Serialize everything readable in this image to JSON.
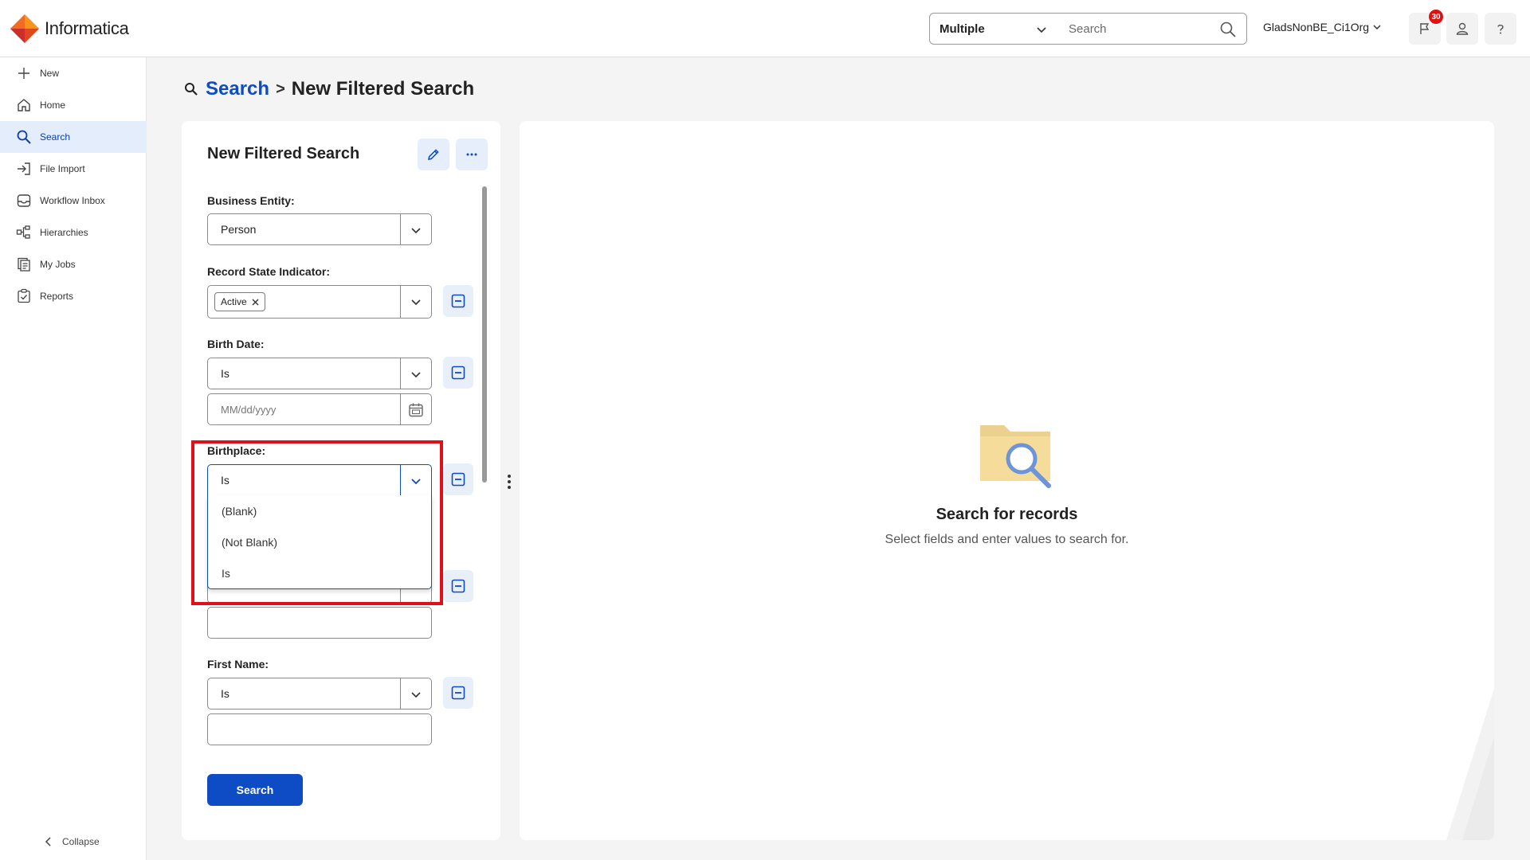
{
  "header": {
    "logo_text": "Informatica",
    "scope_select": "Multiple",
    "search_placeholder": "Search",
    "org_name": "GladsNonBE_Ci1Org",
    "notification_count": "30"
  },
  "sidebar": {
    "items": [
      {
        "label": "New",
        "icon": "plus-icon"
      },
      {
        "label": "Home",
        "icon": "home-icon"
      },
      {
        "label": "Search",
        "icon": "search-icon"
      },
      {
        "label": "File Import",
        "icon": "file-import-icon"
      },
      {
        "label": "Workflow Inbox",
        "icon": "inbox-icon"
      },
      {
        "label": "Hierarchies",
        "icon": "hierarchy-icon"
      },
      {
        "label": "My Jobs",
        "icon": "jobs-icon"
      },
      {
        "label": "Reports",
        "icon": "reports-icon"
      }
    ],
    "active": "Search",
    "collapse_label": "Collapse"
  },
  "breadcrumb": {
    "link": "Search",
    "separator": ">",
    "current": "New Filtered Search"
  },
  "filter_panel": {
    "title": "New Filtered Search",
    "business_entity": {
      "label": "Business Entity:",
      "value": "Person"
    },
    "record_state": {
      "label": "Record State Indicator:",
      "chip": "Active"
    },
    "birth_date": {
      "label": "Birth Date:",
      "operator": "Is",
      "placeholder": "MM/dd/yyyy"
    },
    "birthplace": {
      "label": "Birthplace:",
      "operator": "Is",
      "options": [
        "(Blank)",
        "(Not Blank)",
        "Is"
      ]
    },
    "first_name": {
      "label": "First Name:",
      "operator": "Is"
    },
    "search_button": "Search"
  },
  "results_panel": {
    "title": "Search for records",
    "subtitle": "Select fields and enter values to search for."
  },
  "colors": {
    "brand_blue": "#0d4cc4",
    "highlight_red": "#e0101a",
    "logo_orange": "#f26b21"
  }
}
